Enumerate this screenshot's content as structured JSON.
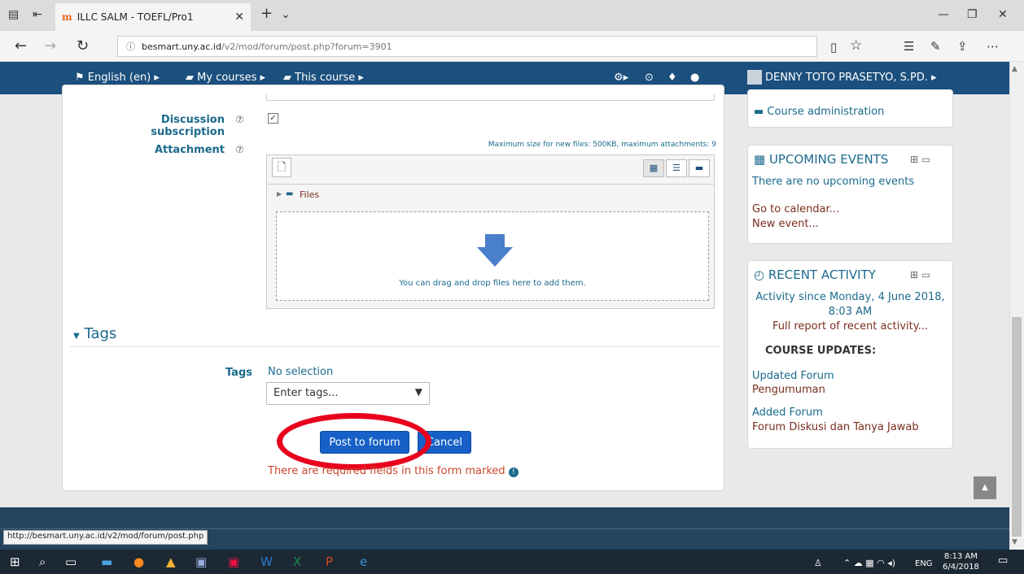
{
  "browser": {
    "tab_title": "ILLC SALM - TOEFL/Pro1",
    "url_host": "besmart.uny.ac.id",
    "url_path": "/v2/mod/forum/post.php?forum=3901"
  },
  "navbar": {
    "language": "English (en) ▸",
    "my_courses": "My courses ▸",
    "this_course": "This course ▸",
    "user": "DENNY TOTO PRASETYO, S.PD. ▸"
  },
  "form": {
    "discussion_subscription": "Discussion subscription",
    "attachment": "Attachment",
    "max_size": "Maximum size for new files: 500KB, maximum attachments: 9",
    "files_folder": "Files",
    "drop_hint": "You can drag and drop files here to add them.",
    "tags_section": "Tags",
    "tags_label": "Tags",
    "tags_selection": "No selection",
    "tags_placeholder": "Enter tags...",
    "post_button": "Post to forum",
    "cancel_button": "Cancel",
    "required_note": "There are required fields in this form marked"
  },
  "sidebar": {
    "course_admin": "Course administration",
    "upcoming": {
      "title": "UPCOMING EVENTS",
      "none": "There are no upcoming events",
      "go_calendar": "Go to calendar...",
      "new_event": "New event..."
    },
    "recent": {
      "title": "RECENT ACTIVITY",
      "since_line1": "Activity since Monday, 4 June 2018,",
      "since_line2": "8:03 AM",
      "full_report": "Full report of recent activity...",
      "updates_heading": "COURSE UPDATES:",
      "update1_type": "Updated Forum",
      "update1_name": "Pengumuman",
      "update2_type": "Added Forum",
      "update2_name": "Forum Diskusi dan Tanya Jawab"
    }
  },
  "status_url": "http://besmart.uny.ac.id/v2/mod/forum/post.php",
  "taskbar": {
    "lang": "ENG",
    "time": "8:13 AM",
    "date": "6/4/2018"
  },
  "colors": {
    "navbar": "#1b4f7d",
    "primary_button": "#1660c7",
    "highlight_oval": "#e8001c",
    "link_blue": "#1b6a8c"
  }
}
